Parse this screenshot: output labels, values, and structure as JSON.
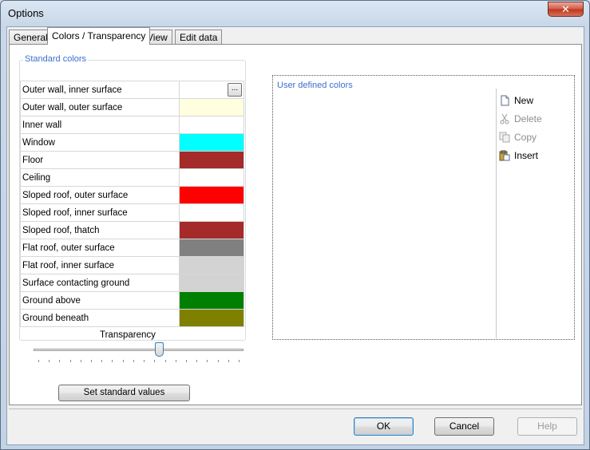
{
  "window": {
    "title": "Options",
    "close_symbol": "✕"
  },
  "tabs": [
    {
      "label": "General"
    },
    {
      "label": "Colors / Transparency",
      "active": true
    },
    {
      "label": "View"
    },
    {
      "label": "Edit data"
    }
  ],
  "standard_colors": {
    "label": "Standard colors",
    "rows": [
      {
        "name": "Outer wall, inner surface",
        "color": "#ffffff",
        "browse": "..."
      },
      {
        "name": "Outer wall, outer surface",
        "color": "#ffffe0"
      },
      {
        "name": "Inner wall",
        "color": "#ffffff"
      },
      {
        "name": "Window",
        "color": "#00ffff"
      },
      {
        "name": "Floor",
        "color": "#a52a2a"
      },
      {
        "name": "Ceiling",
        "color": "#ffffff"
      },
      {
        "name": "Sloped roof, outer surface",
        "color": "#ff0000"
      },
      {
        "name": "Sloped roof, inner surface",
        "color": "#ffffff"
      },
      {
        "name": "Sloped roof, thatch",
        "color": "#a52a2a"
      },
      {
        "name": "Flat roof, outer surface",
        "color": "#808080"
      },
      {
        "name": "Flat roof, inner surface",
        "color": "#d3d3d3"
      },
      {
        "name": "Surface contacting ground",
        "color": "#d3d3d3"
      },
      {
        "name": "Ground above",
        "color": "#008000"
      },
      {
        "name": "Ground beneath",
        "color": "#808000"
      }
    ]
  },
  "user_colors": {
    "label": "User defined colors",
    "actions": [
      {
        "label": "New",
        "icon": "new-document-icon",
        "enabled": true
      },
      {
        "label": "Delete",
        "icon": "scissors-icon",
        "enabled": false
      },
      {
        "label": "Copy",
        "icon": "copy-icon",
        "enabled": false
      },
      {
        "label": "Insert",
        "icon": "paste-icon",
        "enabled": true
      }
    ]
  },
  "transparency": {
    "label": "Transparency",
    "value_fraction": 0.6,
    "tick_count": 20
  },
  "buttons": {
    "set_standard": "Set standard values",
    "ok": "OK",
    "cancel": "Cancel",
    "help": "Help"
  }
}
